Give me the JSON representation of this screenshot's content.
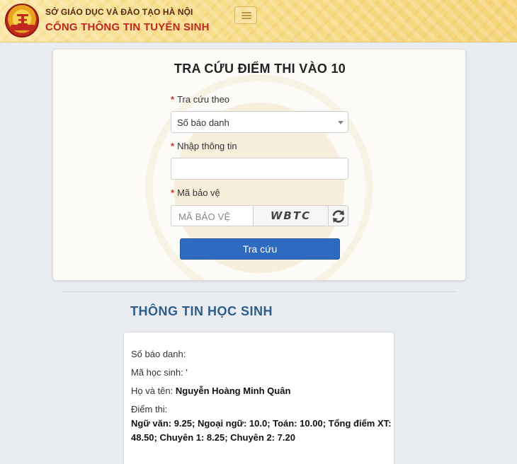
{
  "header": {
    "org_name": "SỞ GIÁO DỤC VÀ ĐÀO TẠO HÀ NỘI",
    "portal_name": "CỔNG THÔNG TIN TUYỂN SINH"
  },
  "search_form": {
    "title": "TRA CỨU ĐIỂM THI VÀO 10",
    "required_marker": "*",
    "lookup_by_label": "Tra cứu theo",
    "lookup_by_value": "Số báo danh",
    "info_label": "Nhập thông tin",
    "info_value": "",
    "captcha_label": "Mã bảo vệ",
    "captcha_placeholder": "MÃ BẢO VỆ",
    "captcha_text": "WBTC",
    "submit_label": "Tra cứu"
  },
  "student_info": {
    "section_title": "THÔNG TIN HỌC SINH",
    "candidate_number_label": "Số báo danh:",
    "student_id_label": "Mã học sinh: '",
    "name_label": "Họ và tên:",
    "name_value": "Nguyễn Hoàng Minh Quân",
    "scores_label": "Điểm thi:",
    "scores_value": "Ngữ văn: 9.25; Ngoại ngữ: 10.0; Toán: 10.00; Tổng điểm XT: 48.50; Chuyên 1: 8.25; Chuyên 2: 7.20"
  },
  "colors": {
    "header_bg": "#f8dd8a",
    "portal_red": "#c0281f",
    "button_blue": "#2d6ac0",
    "section_title_blue": "#2f5d8a",
    "required_red": "#d0302a"
  },
  "icons": {
    "logo": "hanoi-education-logo",
    "menu": "hamburger-menu-icon",
    "refresh": "refresh-icon",
    "dropdown": "chevron-down-icon"
  }
}
